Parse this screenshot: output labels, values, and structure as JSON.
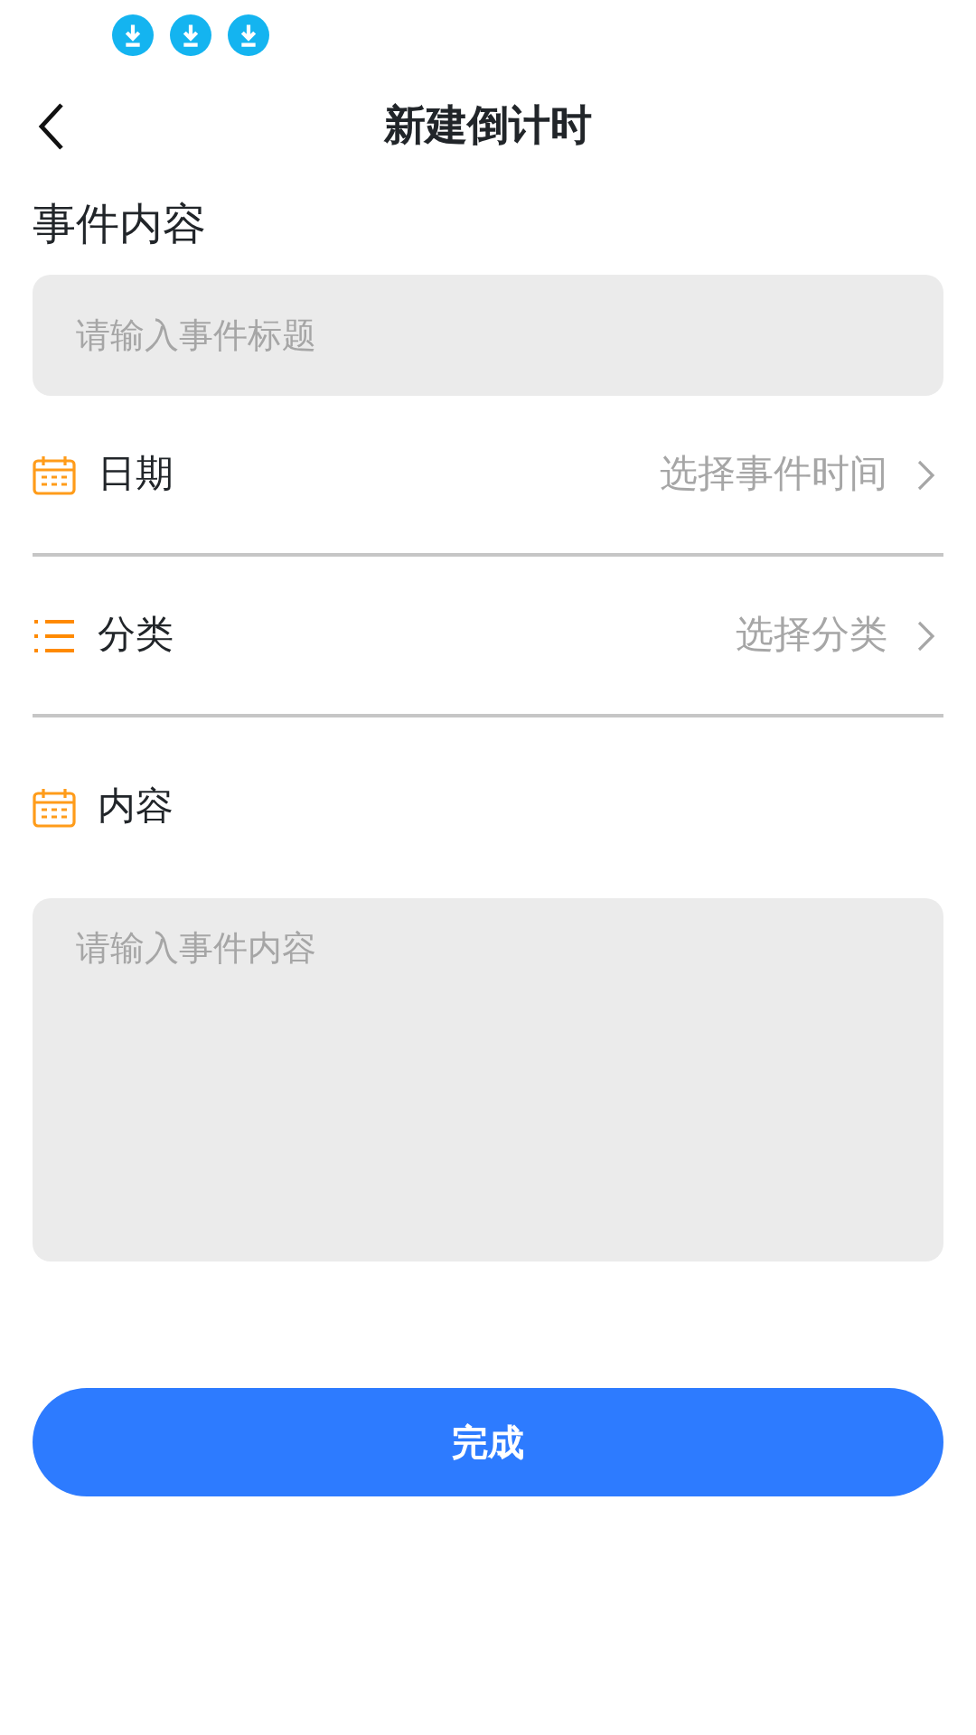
{
  "header": {
    "title": "新建倒计时"
  },
  "section_title": "事件内容",
  "title_field": {
    "placeholder": "请输入事件标题"
  },
  "rows": [
    {
      "kind": "date",
      "label": "日期",
      "value": "选择事件时间"
    },
    {
      "kind": "category",
      "label": "分类",
      "value": "选择分类"
    },
    {
      "kind": "content",
      "label": "内容"
    }
  ],
  "content_field": {
    "placeholder": "请输入事件内容"
  },
  "submit_button": "完成"
}
